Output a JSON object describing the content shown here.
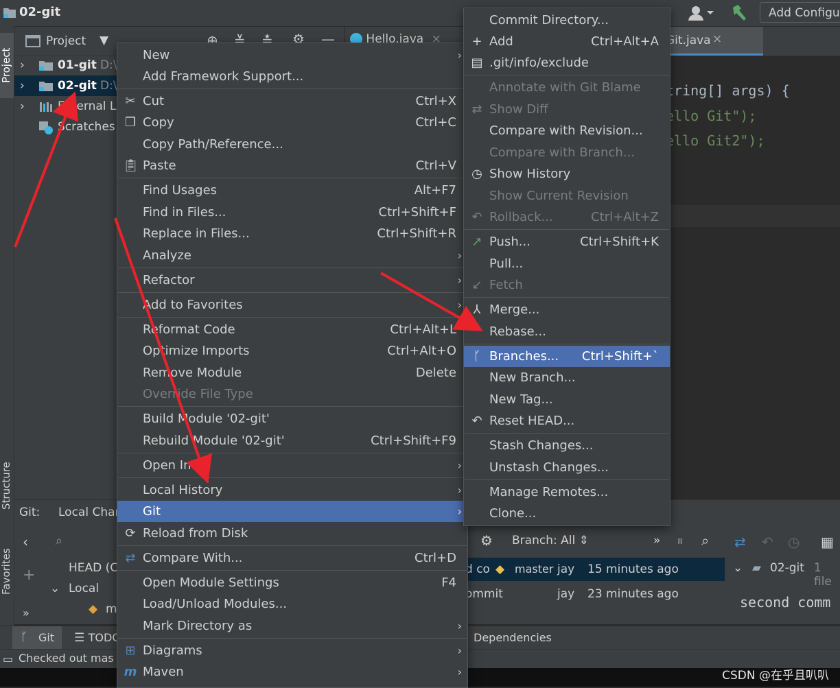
{
  "title": "02-git",
  "toolbar": {
    "add_config": "Add Configu"
  },
  "left_strip": {
    "project": "Project",
    "structure": "Structure",
    "favorites": "Favorites"
  },
  "project": {
    "header": "Project",
    "tree": [
      {
        "label": "01-git",
        "path": "D:\\",
        "expanded": false
      },
      {
        "label": "02-git",
        "path": "D:\\",
        "expanded": false,
        "selected": true
      },
      {
        "label": "External Li"
      },
      {
        "label": "Scratches"
      }
    ]
  },
  "editor": {
    "tabs": [
      "Hello.java",
      "Git.java"
    ],
    "code": [
      "tring[] args) {",
      "ello Git\");",
      "ello Git2\");"
    ]
  },
  "git_panel": {
    "tab_git": "Git:",
    "tab_local": "Local Char",
    "branches": {
      "head": "HEAD (C",
      "local": "Local",
      "m": "m"
    },
    "branch_filter": "Branch: All",
    "log": [
      {
        "msg": "d co",
        "tag": "master",
        "author": "jay",
        "time": "15 minutes ago"
      },
      {
        "msg": "ommit",
        "author": "jay",
        "time": "23 minutes ago"
      }
    ],
    "detail_root": "02-git",
    "detail_count": "1 file",
    "commit_text": "second comm"
  },
  "bottom_tools": {
    "git": "Git",
    "todo": "TODO",
    "dependencies": "Dependencies"
  },
  "status": "Checked out mas",
  "watermark": "CSDN @在乎且叭叭",
  "context_menu": {
    "new": "New",
    "add_framework": "Add Framework Support...",
    "cut": "Cut",
    "cut_sc": "Ctrl+X",
    "copy": "Copy",
    "copy_sc": "Ctrl+C",
    "copy_path": "Copy Path/Reference...",
    "paste": "Paste",
    "paste_sc": "Ctrl+V",
    "find_usages": "Find Usages",
    "find_usages_sc": "Alt+F7",
    "find_in_files": "Find in Files...",
    "find_in_files_sc": "Ctrl+Shift+F",
    "replace_in_files": "Replace in Files...",
    "replace_in_files_sc": "Ctrl+Shift+R",
    "analyze": "Analyze",
    "refactor": "Refactor",
    "add_to_favorites": "Add to Favorites",
    "reformat": "Reformat Code",
    "reformat_sc": "Ctrl+Alt+L",
    "optimize": "Optimize Imports",
    "optimize_sc": "Ctrl+Alt+O",
    "remove_module": "Remove Module",
    "remove_module_sc": "Delete",
    "override_type": "Override File Type",
    "build_module": "Build Module '02-git'",
    "rebuild_module": "Rebuild Module '02-git'",
    "rebuild_module_sc": "Ctrl+Shift+F9",
    "open_in": "Open In",
    "local_history": "Local History",
    "git": "Git",
    "reload": "Reload from Disk",
    "compare_with": "Compare With...",
    "compare_with_sc": "Ctrl+D",
    "module_settings": "Open Module Settings",
    "module_settings_sc": "F4",
    "load_unload": "Load/Unload Modules...",
    "mark_dir": "Mark Directory as",
    "diagrams": "Diagrams",
    "maven": "Maven"
  },
  "git_menu": {
    "commit_dir": "Commit Directory...",
    "add": "Add",
    "add_sc": "Ctrl+Alt+A",
    "exclude": ".git/info/exclude",
    "annotate": "Annotate with Git Blame",
    "show_diff": "Show Diff",
    "compare_rev": "Compare with Revision...",
    "compare_branch": "Compare with Branch...",
    "show_history": "Show History",
    "show_current": "Show Current Revision",
    "rollback": "Rollback...",
    "rollback_sc": "Ctrl+Alt+Z",
    "push": "Push...",
    "push_sc": "Ctrl+Shift+K",
    "pull": "Pull...",
    "fetch": "Fetch",
    "merge": "Merge...",
    "rebase": "Rebase...",
    "branches": "Branches...",
    "branches_sc": "Ctrl+Shift+`",
    "new_branch": "New Branch...",
    "new_tag": "New Tag...",
    "reset_head": "Reset HEAD...",
    "stash": "Stash Changes...",
    "unstash": "Unstash Changes...",
    "manage_remotes": "Manage Remotes...",
    "clone": "Clone..."
  },
  "colors": {
    "accent": "#4b6eaf",
    "annotation_arrow": "#e8232b",
    "string": "#6a8759",
    "vcs_green": "#59a869"
  }
}
